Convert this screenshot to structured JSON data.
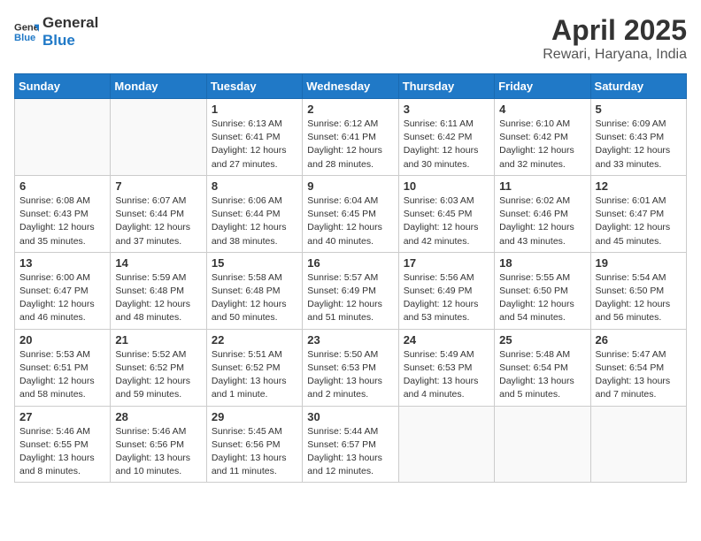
{
  "header": {
    "logo_line1": "General",
    "logo_line2": "Blue",
    "title": "April 2025",
    "subtitle": "Rewari, Haryana, India"
  },
  "days_of_week": [
    "Sunday",
    "Monday",
    "Tuesday",
    "Wednesday",
    "Thursday",
    "Friday",
    "Saturday"
  ],
  "weeks": [
    [
      {
        "day": "",
        "info": ""
      },
      {
        "day": "",
        "info": ""
      },
      {
        "day": "1",
        "info": "Sunrise: 6:13 AM\nSunset: 6:41 PM\nDaylight: 12 hours and 27 minutes."
      },
      {
        "day": "2",
        "info": "Sunrise: 6:12 AM\nSunset: 6:41 PM\nDaylight: 12 hours and 28 minutes."
      },
      {
        "day": "3",
        "info": "Sunrise: 6:11 AM\nSunset: 6:42 PM\nDaylight: 12 hours and 30 minutes."
      },
      {
        "day": "4",
        "info": "Sunrise: 6:10 AM\nSunset: 6:42 PM\nDaylight: 12 hours and 32 minutes."
      },
      {
        "day": "5",
        "info": "Sunrise: 6:09 AM\nSunset: 6:43 PM\nDaylight: 12 hours and 33 minutes."
      }
    ],
    [
      {
        "day": "6",
        "info": "Sunrise: 6:08 AM\nSunset: 6:43 PM\nDaylight: 12 hours and 35 minutes."
      },
      {
        "day": "7",
        "info": "Sunrise: 6:07 AM\nSunset: 6:44 PM\nDaylight: 12 hours and 37 minutes."
      },
      {
        "day": "8",
        "info": "Sunrise: 6:06 AM\nSunset: 6:44 PM\nDaylight: 12 hours and 38 minutes."
      },
      {
        "day": "9",
        "info": "Sunrise: 6:04 AM\nSunset: 6:45 PM\nDaylight: 12 hours and 40 minutes."
      },
      {
        "day": "10",
        "info": "Sunrise: 6:03 AM\nSunset: 6:45 PM\nDaylight: 12 hours and 42 minutes."
      },
      {
        "day": "11",
        "info": "Sunrise: 6:02 AM\nSunset: 6:46 PM\nDaylight: 12 hours and 43 minutes."
      },
      {
        "day": "12",
        "info": "Sunrise: 6:01 AM\nSunset: 6:47 PM\nDaylight: 12 hours and 45 minutes."
      }
    ],
    [
      {
        "day": "13",
        "info": "Sunrise: 6:00 AM\nSunset: 6:47 PM\nDaylight: 12 hours and 46 minutes."
      },
      {
        "day": "14",
        "info": "Sunrise: 5:59 AM\nSunset: 6:48 PM\nDaylight: 12 hours and 48 minutes."
      },
      {
        "day": "15",
        "info": "Sunrise: 5:58 AM\nSunset: 6:48 PM\nDaylight: 12 hours and 50 minutes."
      },
      {
        "day": "16",
        "info": "Sunrise: 5:57 AM\nSunset: 6:49 PM\nDaylight: 12 hours and 51 minutes."
      },
      {
        "day": "17",
        "info": "Sunrise: 5:56 AM\nSunset: 6:49 PM\nDaylight: 12 hours and 53 minutes."
      },
      {
        "day": "18",
        "info": "Sunrise: 5:55 AM\nSunset: 6:50 PM\nDaylight: 12 hours and 54 minutes."
      },
      {
        "day": "19",
        "info": "Sunrise: 5:54 AM\nSunset: 6:50 PM\nDaylight: 12 hours and 56 minutes."
      }
    ],
    [
      {
        "day": "20",
        "info": "Sunrise: 5:53 AM\nSunset: 6:51 PM\nDaylight: 12 hours and 58 minutes."
      },
      {
        "day": "21",
        "info": "Sunrise: 5:52 AM\nSunset: 6:52 PM\nDaylight: 12 hours and 59 minutes."
      },
      {
        "day": "22",
        "info": "Sunrise: 5:51 AM\nSunset: 6:52 PM\nDaylight: 13 hours and 1 minute."
      },
      {
        "day": "23",
        "info": "Sunrise: 5:50 AM\nSunset: 6:53 PM\nDaylight: 13 hours and 2 minutes."
      },
      {
        "day": "24",
        "info": "Sunrise: 5:49 AM\nSunset: 6:53 PM\nDaylight: 13 hours and 4 minutes."
      },
      {
        "day": "25",
        "info": "Sunrise: 5:48 AM\nSunset: 6:54 PM\nDaylight: 13 hours and 5 minutes."
      },
      {
        "day": "26",
        "info": "Sunrise: 5:47 AM\nSunset: 6:54 PM\nDaylight: 13 hours and 7 minutes."
      }
    ],
    [
      {
        "day": "27",
        "info": "Sunrise: 5:46 AM\nSunset: 6:55 PM\nDaylight: 13 hours and 8 minutes."
      },
      {
        "day": "28",
        "info": "Sunrise: 5:46 AM\nSunset: 6:56 PM\nDaylight: 13 hours and 10 minutes."
      },
      {
        "day": "29",
        "info": "Sunrise: 5:45 AM\nSunset: 6:56 PM\nDaylight: 13 hours and 11 minutes."
      },
      {
        "day": "30",
        "info": "Sunrise: 5:44 AM\nSunset: 6:57 PM\nDaylight: 13 hours and 12 minutes."
      },
      {
        "day": "",
        "info": ""
      },
      {
        "day": "",
        "info": ""
      },
      {
        "day": "",
        "info": ""
      }
    ]
  ]
}
